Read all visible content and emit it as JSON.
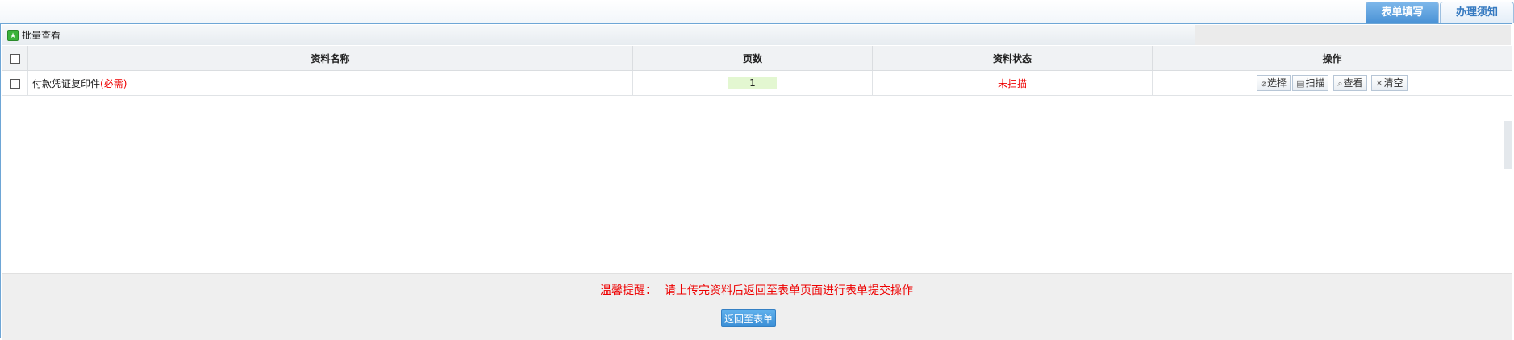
{
  "tabs": [
    {
      "label": "表单填写",
      "active": true
    },
    {
      "label": "办理须知",
      "active": false
    }
  ],
  "toolbar": {
    "batch_view_label": "批量查看"
  },
  "table": {
    "headers": {
      "name": "资料名称",
      "pages": "页数",
      "status": "资料状态",
      "actions": "操作"
    },
    "rows": [
      {
        "name": "付款凭证复印件",
        "required": "(必需)",
        "pages": "1",
        "status": "未扫描",
        "actions": {
          "select": "选择",
          "scan": "扫描",
          "view": "查看",
          "clear": "清空"
        }
      }
    ]
  },
  "footer": {
    "tip_label": "温馨提醒：",
    "tip_text": "请上传完资料后返回至表单页面进行表单提交操作",
    "back_button": "返回至表单"
  },
  "colors": {
    "accent": "#4b93d6",
    "required": "#ee0000",
    "status": "#ee0000",
    "pages_bg": "#e3f7d1"
  }
}
